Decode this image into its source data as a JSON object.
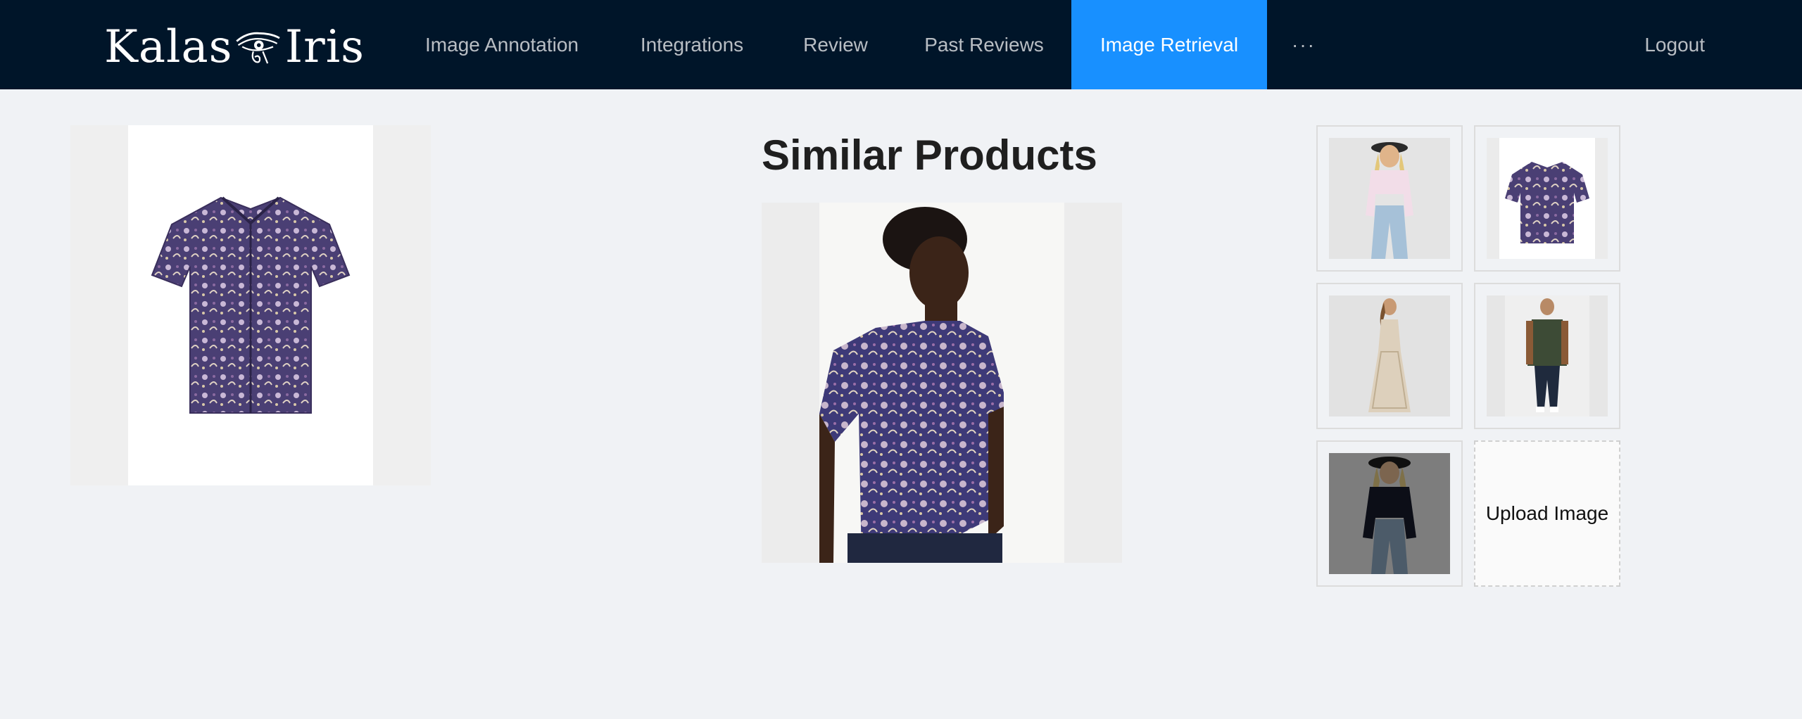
{
  "app": {
    "logo_left": "Kalas",
    "logo_right": "Iris"
  },
  "nav": {
    "items": [
      {
        "label": "Image Annotation"
      },
      {
        "label": "Integrations"
      },
      {
        "label": "Review"
      },
      {
        "label": "Past Reviews"
      },
      {
        "label": "Image Retrieval",
        "active": true
      },
      {
        "label": "···"
      }
    ],
    "logout": "Logout"
  },
  "main": {
    "title": "Similar Products",
    "query_image": {
      "icon": "paisley-shirt-image"
    },
    "result_image": {
      "icon": "model-wearing-paisley-shirt-image"
    }
  },
  "gallery": {
    "thumbnails": [
      {
        "icon": "woman-pink-top-jeans-image"
      },
      {
        "icon": "paisley-shirt-image"
      },
      {
        "icon": "woman-lace-maxi-dress-image"
      },
      {
        "icon": "man-bomber-jacket-image"
      },
      {
        "icon": "woman-black-lace-top-image",
        "selected": true
      }
    ],
    "upload_label": "Upload Image"
  },
  "colors": {
    "header_bg": "#001529",
    "active_nav": "#1890ff",
    "page_bg": "#f0f2f5"
  }
}
